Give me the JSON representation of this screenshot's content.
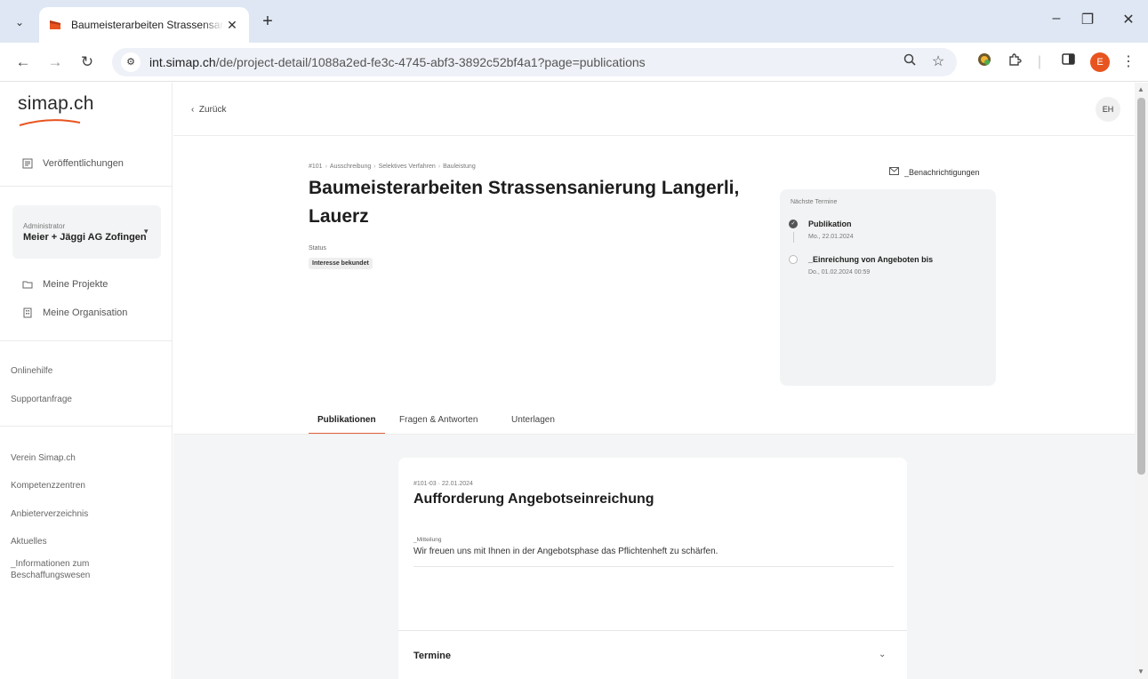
{
  "browser": {
    "tab_title": "Baumeisterarbeiten Strassensanierung Langerli, Lauerz",
    "new_tab_symbol": "+",
    "close_tab_symbol": "✕",
    "url_host": "int.simap.ch",
    "url_path": "/de/project-detail/1088a2ed-fe3c-4745-abf3-3892c52bf4a1?page=publications",
    "profile_initial": "E",
    "accent_color": "#e8541f"
  },
  "sidebar": {
    "logo": "simap.ch",
    "publications": "Veröffentlichungen",
    "org_role": "Administrator",
    "org_name": "Meier + Jäggi AG Zofingen",
    "my_projects": "Meine Projekte",
    "my_org": "Meine Organisation",
    "help_links": [
      "Onlinehilfe",
      "Supportanfrage"
    ],
    "footer_links": [
      "Verein Simap.ch",
      "Kompetenzzentren",
      "Anbieterverzeichnis",
      "Aktuelles",
      "_Informationen zum Beschaffungswesen"
    ]
  },
  "header": {
    "back_label": "Zurück",
    "avatar_initials": "EH"
  },
  "project": {
    "breadcrumb": [
      "#101",
      "Ausschreibung",
      "Selektives Verfahren",
      "Bauleistung"
    ],
    "title": "Baumeisterarbeiten Strassensanierung Langerli, Lauerz",
    "status_label": "Status",
    "status_value": "Interesse bekundet",
    "notifications_label": "_Benachrichtigungen"
  },
  "termine_card": {
    "title": "Nächste Termine",
    "items": [
      {
        "name": "Publikation",
        "date": "Mo., 22.01.2024",
        "state": "done"
      },
      {
        "name": "_Einreichung von Angeboten bis",
        "date": "Do., 01.02.2024 00:59",
        "state": "open"
      }
    ]
  },
  "tabs": [
    {
      "label": "Publikationen",
      "active": true
    },
    {
      "label": "Fragen & Antworten",
      "active": false
    },
    {
      "label": "Unterlagen",
      "active": false
    }
  ],
  "publication": {
    "meta": "#101-03 · 22.01.2024",
    "title": "Aufforderung Angebotseinreichung",
    "field_label": "_Mitteilung",
    "field_text": "Wir freuen uns mit Ihnen in der Angebotsphase das Pflichtenheft zu schärfen.",
    "accordion_title": "Termine"
  }
}
